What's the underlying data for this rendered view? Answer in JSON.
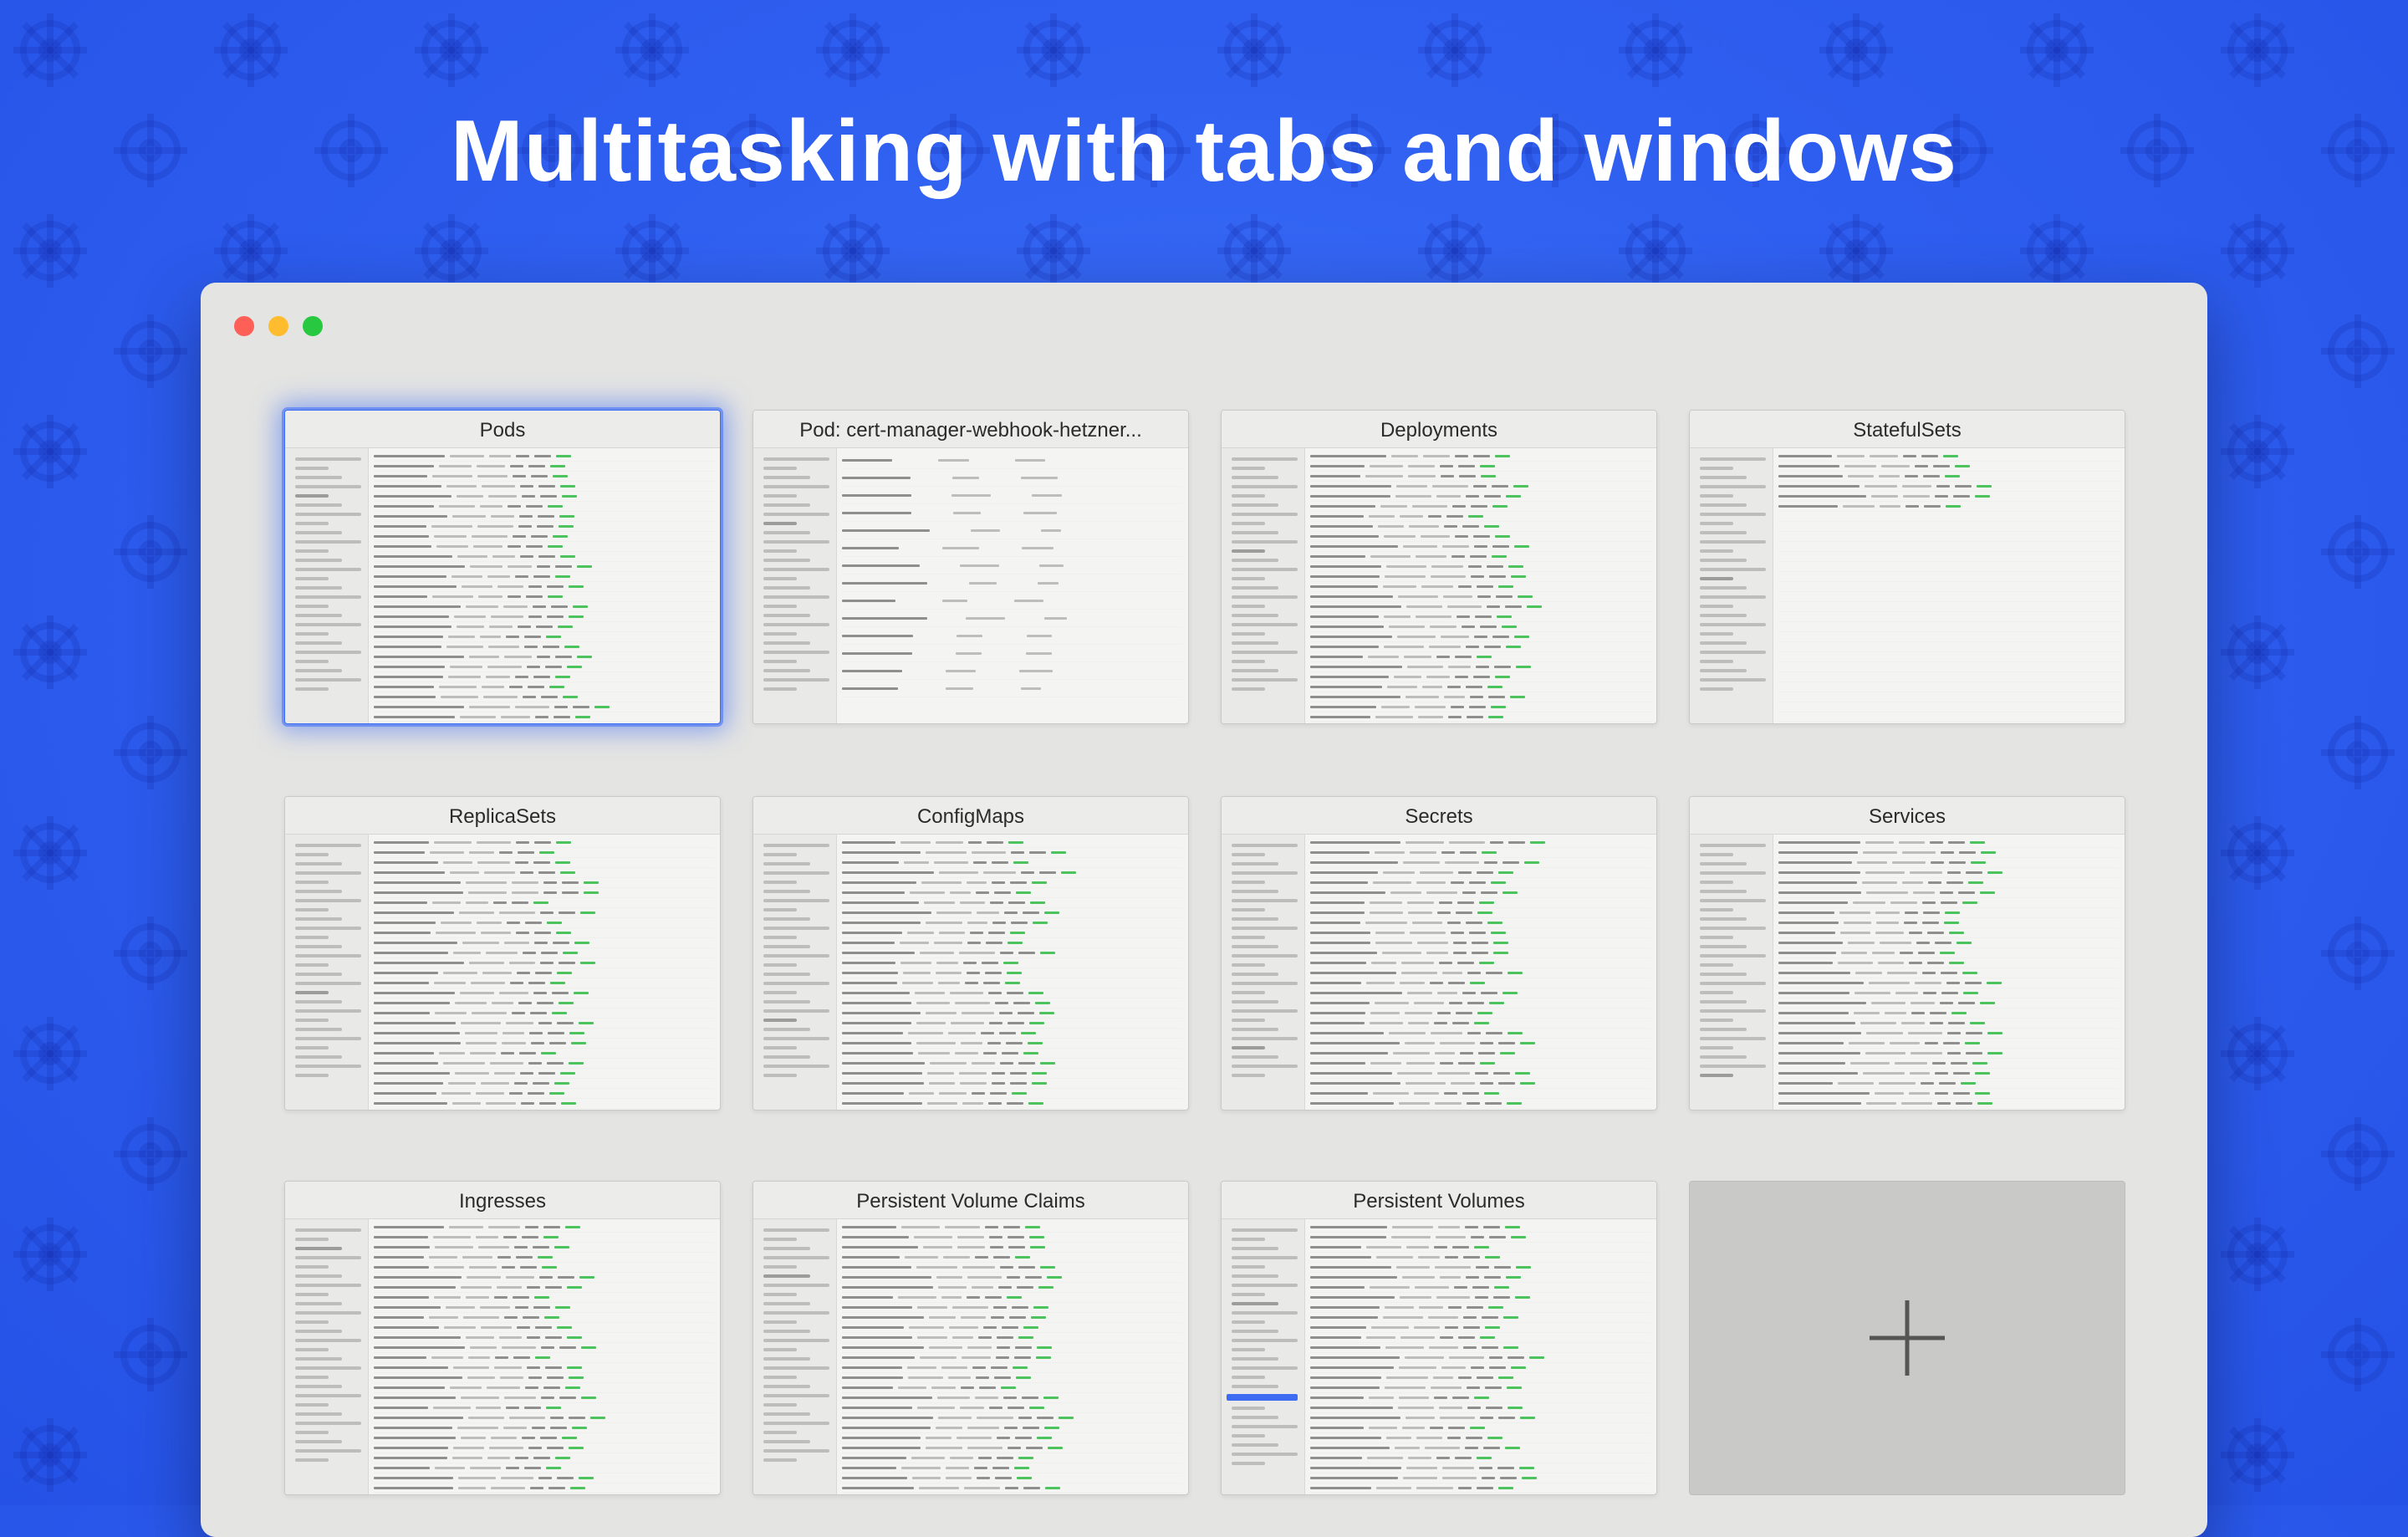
{
  "headline": "Multitasking with tabs and windows",
  "window": {
    "tabs": [
      {
        "title": "Pods",
        "selected": true,
        "style": "pods"
      },
      {
        "title": "Pod: cert-manager-webhook-hetzner...",
        "selected": false,
        "style": "detail"
      },
      {
        "title": "Deployments",
        "selected": false,
        "style": "list"
      },
      {
        "title": "StatefulSets",
        "selected": false,
        "style": "sparse"
      },
      {
        "title": "ReplicaSets",
        "selected": false,
        "style": "list"
      },
      {
        "title": "ConfigMaps",
        "selected": false,
        "style": "list"
      },
      {
        "title": "Secrets",
        "selected": false,
        "style": "list"
      },
      {
        "title": "Services",
        "selected": false,
        "style": "list"
      },
      {
        "title": "Ingresses",
        "selected": false,
        "style": "list"
      },
      {
        "title": "Persistent Volume Claims",
        "selected": false,
        "style": "pvc"
      },
      {
        "title": "Persistent Volumes",
        "selected": false,
        "style": "pv"
      }
    ],
    "new_tab_icon": "plus-icon"
  },
  "colors": {
    "background": "#2f5ff0",
    "window": "#e4e4e2",
    "selected_glow": "#3e6ef5",
    "status_green": "#4cc35c"
  }
}
